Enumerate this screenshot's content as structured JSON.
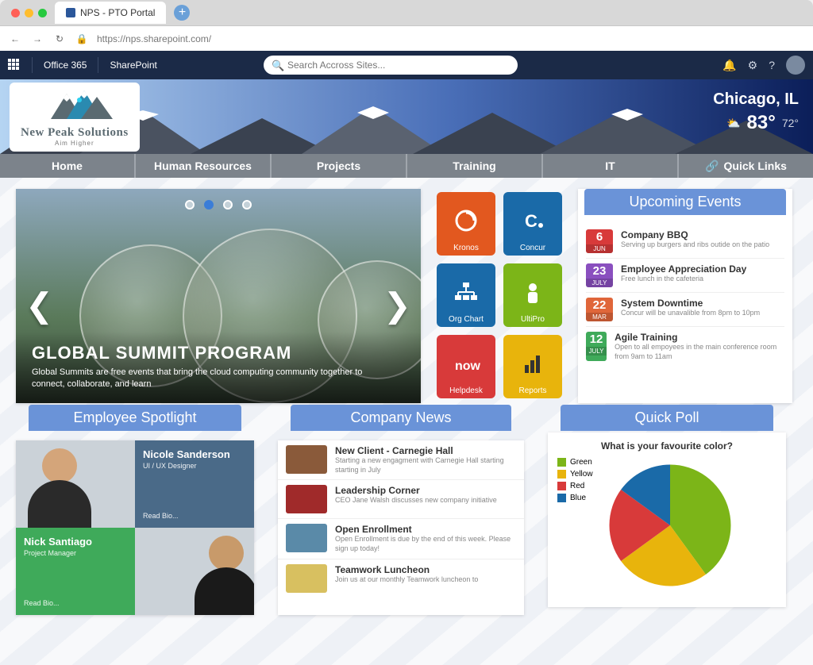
{
  "browser": {
    "tab_title": "NPS - PTO Portal",
    "url": "https://nps.sharepoint.com/"
  },
  "suite": {
    "office": "Office 365",
    "app": "SharePoint",
    "search_placeholder": "Search Accross Sites..."
  },
  "logo": {
    "company": "New Peak Solutions",
    "tagline": "Aim Higher"
  },
  "weather": {
    "city": "Chicago, IL",
    "hi": "83°",
    "lo": "72°"
  },
  "nav": [
    "Home",
    "Human Resources",
    "Projects",
    "Training",
    "IT",
    "Quick Links"
  ],
  "hero": {
    "title": "GLOBAL SUMMIT PROGRAM",
    "subtitle": "Global Summits are free events that bring the cloud computing community together to connect, collaborate, and learn",
    "active_dot": 1,
    "dot_count": 4
  },
  "tiles": [
    {
      "label": "Kronos",
      "color": "#e2581f"
    },
    {
      "label": "Concur",
      "color": "#1a6aa8"
    },
    {
      "label": "Org Chart",
      "color": "#1a6aa8"
    },
    {
      "label": "UltiPro",
      "color": "#7cb518"
    },
    {
      "label": "Helpdesk",
      "color": "#d83a3a"
    },
    {
      "label": "Reports",
      "color": "#e8b40c"
    }
  ],
  "events_header": "Upcoming Events",
  "events": [
    {
      "day": "6",
      "month": "JUN",
      "color": "#d83a3a",
      "title": "Company BBQ",
      "desc": "Serving up burgers and ribs outide on the patio"
    },
    {
      "day": "23",
      "month": "JULY",
      "color": "#8a4fbf",
      "title": "Employee Appreciation Day",
      "desc": "Free lunch in the cafeteria"
    },
    {
      "day": "22",
      "month": "MAR",
      "color": "#e0663a",
      "title": "System Downtime",
      "desc": "Concur will be unavalible from 8pm to 10pm"
    },
    {
      "day": "12",
      "month": "JULY",
      "color": "#3faa5a",
      "title": "Agile Training",
      "desc": "Open to all empoyees in the main conference room from 9am to 11am"
    }
  ],
  "spotlight_header": "Employee Spotlight",
  "spotlight": {
    "person1": {
      "name": "Nicole Sanderson",
      "role": "UI / UX Designer",
      "link": "Read Bio..."
    },
    "person2": {
      "name": "Nick Santiago",
      "role": "Project Manager",
      "link": "Read Bio..."
    }
  },
  "news_header": "Company News",
  "news": [
    {
      "title": "New Client - Carnegie Hall",
      "desc": "Starting a new engagment with Carnegie Hall starting starting in July",
      "thumb": "#8a5a3a"
    },
    {
      "title": "Leadership Corner",
      "desc": "CEO Jane Walsh discusses new company initiative",
      "thumb": "#a02a2a"
    },
    {
      "title": "Open Enrollment",
      "desc": "Open Enrollment is due by the end of this week. Please sign up today!",
      "thumb": "#5a8aa8"
    },
    {
      "title": "Teamwork Luncheon",
      "desc": "Join us at our monthly Teamwork luncheon to",
      "thumb": "#d8c060"
    }
  ],
  "poll_header": "Quick Poll",
  "poll": {
    "question": "What is your favourite color?",
    "legend": [
      {
        "label": "Green",
        "color": "#7cb518"
      },
      {
        "label": "Yellow",
        "color": "#e8b40c"
      },
      {
        "label": "Red",
        "color": "#d83a3a"
      },
      {
        "label": "Blue",
        "color": "#1a6aa8"
      }
    ]
  },
  "chart_data": {
    "type": "pie",
    "title": "What is your favourite color?",
    "categories": [
      "Green",
      "Yellow",
      "Red",
      "Blue"
    ],
    "values": [
      40,
      25,
      20,
      15
    ],
    "colors": [
      "#7cb518",
      "#e8b40c",
      "#d83a3a",
      "#1a6aa8"
    ]
  }
}
